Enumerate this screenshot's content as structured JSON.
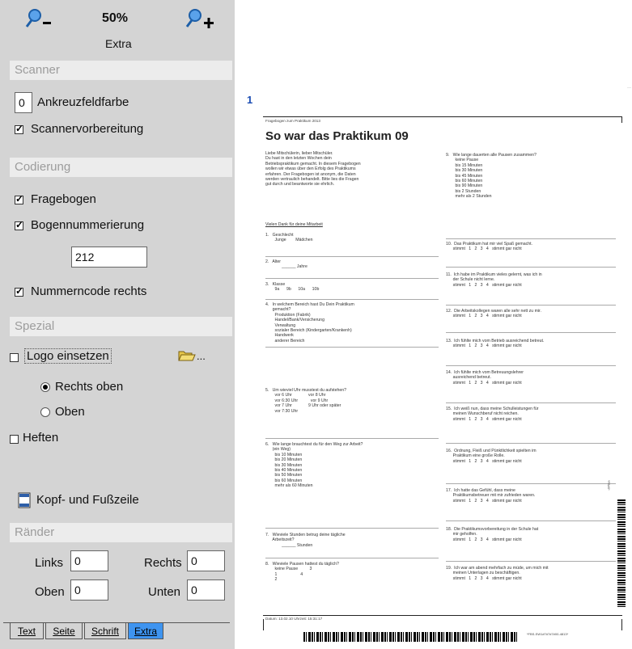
{
  "zoom": {
    "value": "50%",
    "out_icon": "zoom-out-icon",
    "in_icon": "zoom-in-icon"
  },
  "active_tab_title": "Extra",
  "sections": {
    "scanner": "Scanner",
    "codierung": "Codierung",
    "spezial": "Spezial",
    "raender": "Ränder"
  },
  "scanner": {
    "ankreuz_value": "0",
    "ankreuz_label": "Ankreuzfeldfarbe",
    "vorbereitung_label": "Scannervorbereitung",
    "vorbereitung_checked": true
  },
  "codierung": {
    "fragebogen_label": "Fragebogen",
    "fragebogen_checked": true,
    "nummerierung_label": "Bogennummerierung",
    "nummerierung_checked": true,
    "nummer_value": "212",
    "nummerncode_label": "Nummerncode rechts",
    "nummerncode_checked": true
  },
  "spezial": {
    "logo_label": "Logo einsetzen",
    "logo_checked": false,
    "folder_suffix": "...",
    "rechts_oben": "Rechts oben",
    "oben": "Oben",
    "rechts_oben_selected": true,
    "heften_label": "Heften",
    "heften_checked": false,
    "kopf_label": "Kopf- und Fußzeile"
  },
  "raender": {
    "links_label": "Links",
    "links_value": "0",
    "rechts_label": "Rechts",
    "rechts_value": "0",
    "oben_label": "Oben",
    "oben_value": "0",
    "unten_label": "Unten",
    "unten_value": "0"
  },
  "tabs": [
    "Text",
    "Seite",
    "Schrift",
    "Extra"
  ],
  "active_tab": "Extra",
  "page_number": "1",
  "document": {
    "header_small": "Fragebogen zum Praktikum 2013",
    "title": "So war das Praktikum 09",
    "intro": "Liebe Mitschülerin, lieber Mitschüler.\nDu hast in den letzten Wochen dein\nBetriebspraktikum gemacht. In diesem Fragebogen\nwollen wir etwas über den Erfolg des Praktikums\nerfahren. Der Fragebogen ist anonym, die Daten\nwerden vertraulich behandelt. Bitte lies die Fragen\ngut durch und beantworte sie ehrlich.",
    "thanks": "Vielen Dank für deine Mitarbeit",
    "left_questions": [
      "1.   Geschlecht\n        Junge        Mädchen",
      "2.   Alter\n              ______ Jahre",
      "3.   Klasse\n        9a      9b      10a      10b",
      "4.   In welchem Bereich hast Du Dein Praktikum\n      gemacht?\n        Produktion (Fabrik)\n        Handel/Bank/Versicherung\n        Verwaltung\n        sozialer Bereich (Kindergarten/Krankenh)\n        Handwerk\n        anderer Bereich",
      "5.   Um wieviel Uhr musstest du aufstehen?\n        vor 6 Uhr              vor 8 Uhr\n        vor 6:30 Uhr           vor 9 Uhr\n        vor 7 Uhr              9 Uhr oder später\n        vor 7:30 Uhr",
      "6.   Wie lange brauchtest du für den Weg zur Arbeit?\n      (ein Weg)\n        bis 10 Minuten\n        bis 20 Minuten\n        bis 30 Minuten\n        bis 40 Minuten\n        bis 50 Minuten\n        bis 60 Minuten\n        mehr als 60 Minuten",
      "7.   Wieviele Stunden betrug deine tägliche\n      Arbeitszeit?\n              ______ Stunden",
      "8.   Wieviele Pausen hattest du täglich?\n        keine Pause          3\n        1                    4\n        2"
    ],
    "right_questions": [
      "9.   Wie lange dauerten alle Pausen zusammen?\n        keine Pause\n        bis 15 Minuten\n        bis 30 Minuten\n        bis 45 Minuten\n        bis 60 Minuten\n        bis 90 Minuten\n        bis 2 Stunden\n        mehr als 2 Stunden",
      "10.  Das Praktikum hat mir viel Spaß gemacht.\n      stimmt   1   2   3   4   stimmt gar nicht",
      "11.  Ich habe im Praktikum vieles gelernt, was ich in\n      der Schule nicht lerne.\n      stimmt   1   2   3   4   stimmt gar nicht",
      "12.  Die Arbeitskollegen waren alle sehr nett zu mir.\n      stimmt   1   2   3   4   stimmt gar nicht",
      "13.  Ich fühlte mich vom Betrieb ausreichend betreut.\n      stimmt   1   2   3   4   stimmt gar nicht",
      "14.  Ich fühlte mich vom Betreuungslehrer\n      ausreichend betreut.\n      stimmt   1   2   3   4   stimmt gar nicht",
      "15.  Ich weiß nun, dass meine Schulleistungen für\n      meinen Wunschberuf nicht reichen.\n      stimmt   1   2   3   4   stimmt gar nicht",
      "16.  Ordnung, Fleiß und Pünktlichkeit spielten im\n      Praktikum eine große Rolle.\n      stimmt   1   2   3   4   stimmt gar nicht",
      "17.  Ich hatte das Gefühl, dass meine\n      Praktikumsbetreuer mit mir zufrieden waren.\n      stimmt   1   2   3   4   stimmt gar nicht",
      "18.  Die Praktikumsvorbereitung in der Schule hat\n      mir geholfen.\n      stimmt   1   2   3   4   stimmt gar nicht",
      "19.  Ich war am abend mehrfach zu müde, um mich mit\n      meinen Unterlagen zu beschäftigen.\n      stimmt   1   2   3   4   stimmt gar nicht"
    ],
    "footer_small": "Datum: 13.02.10  Uhrzeit: 15:31:17",
    "footer_code": "*FBS-SW1#7#7#7#00-4813*",
    "side_code": "*FB#0*"
  }
}
